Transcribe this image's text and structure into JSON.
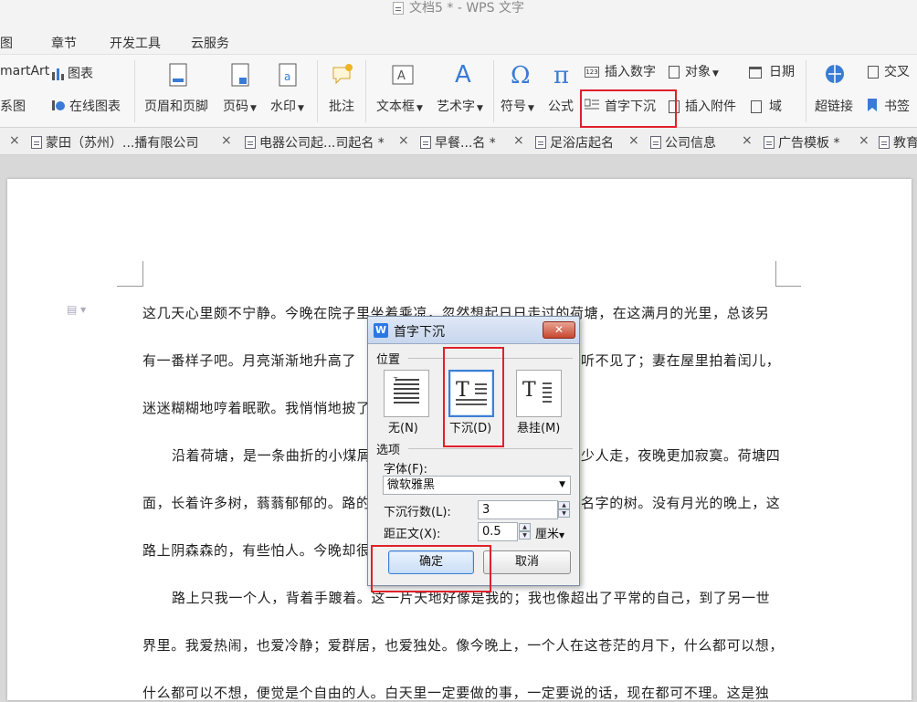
{
  "window": {
    "title": "文档5 * - WPS 文字"
  },
  "menu": {
    "items": [
      "图",
      "章节",
      "开发工具",
      "云服务"
    ]
  },
  "ribbon": {
    "smartart": "martArt",
    "chart": "图表",
    "relation": "系图",
    "online_chart": "在线图表",
    "header_footer": "页眉和页脚",
    "page_number": "页码",
    "watermark": "水印",
    "comment": "批注",
    "textbox": "文本框",
    "wordart": "艺术字",
    "symbol": "符号",
    "formula": "公式",
    "insert_number": "插入数字",
    "object": "对象",
    "date": "日期",
    "drop_cap": "首字下沉",
    "insert_attachment": "插入附件",
    "field": "域",
    "hyperlink": "超链接",
    "cross_ref": "交叉",
    "bookmark": "书签"
  },
  "tabs": [
    "蒙田（苏州）...播有限公司",
    "电器公司起...司起名 *",
    "早餐...名 *",
    "足浴店起名",
    "公司信息",
    "广告模板 *",
    "教育"
  ],
  "document": {
    "lines": [
      "这几天心里颇不宁静。今晚在院子里坐着乘凉，忽然想起日日走过的荷塘，在这满月的光里，总该另",
      "有一番样子吧。月亮渐渐地升高了",
      "听不见了；妻在屋里拍着闰儿，",
      "迷迷糊糊地哼着眠歌。我悄悄地披了",
      "沿着荷塘，是一条曲折的小煤屑",
      "少人走，夜晚更加寂寞。荷塘四",
      "面，长着许多树，蓊蓊郁郁的。路的",
      "名字的树。没有月光的晚上，这",
      "路上阴森森的，有些怕人。今晚却很",
      "路上只我一个人，背着手踱着。这一片天地好像是我的；我也像超出了平常的自己，到了另一世",
      "界里。我爱热闹，也爱冷静；爱群居，也爱独处。像今晚上，一个人在这苍茫的月下，什么都可以想，",
      "什么都可以不想，便觉是个自由的人。白天里一定要做的事，一定要说的话，现在都可不理。这是独"
    ]
  },
  "dialog": {
    "title": "首字下沉",
    "close_label": "✕",
    "position_group": "位置",
    "opt_none": "无(N)",
    "opt_drop": "下沉(D)",
    "opt_margin": "悬挂(M)",
    "options_group": "选项",
    "font_label": "字体(F):",
    "font_value": "微软雅黑",
    "lines_label": "下沉行数(L):",
    "lines_value": "3",
    "distance_label": "距正文(X):",
    "distance_value": "0.5",
    "distance_unit": "厘米",
    "ok_label": "确定",
    "cancel_label": "取消"
  },
  "colors": {
    "highlight": "#e0202a",
    "accent": "#2b78e4"
  }
}
